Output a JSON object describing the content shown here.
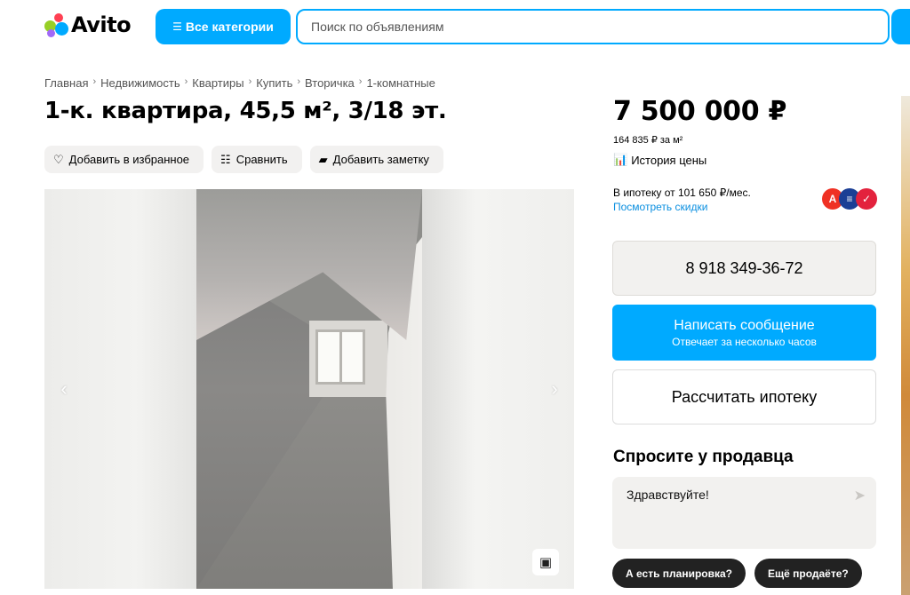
{
  "header": {
    "logo_text": "Avito",
    "categories_label": "Все категории",
    "search_placeholder": "Поиск по объявлениям"
  },
  "breadcrumbs": [
    "Главная",
    "Недвижимость",
    "Квартиры",
    "Купить",
    "Вторичка",
    "1-комнатные"
  ],
  "listing": {
    "title": "1-к. квартира, 45,5 м², 3/18 эт.",
    "actions": {
      "favorite": "Добавить в избранное",
      "compare": "Сравнить",
      "note": "Добавить заметку"
    }
  },
  "gallery": {
    "prev_arrow": "‹",
    "next_arrow": "›"
  },
  "sidebar": {
    "price": "7 500 000 ₽",
    "price_per_m2": "164 835 ₽ за м²",
    "price_history": "История цены",
    "mortgage_text": "В ипотеку от 101 650 ₽/мес.",
    "mortgage_link": "Посмотреть скидки",
    "phone": "8 918 349-36-72",
    "message_button": "Написать сообщение",
    "message_sub": "Отвечает за несколько часов",
    "calc_mortgage": "Рассчитать ипотеку",
    "ask_title": "Спросите у продавца",
    "ask_text": "Здравствуйте!",
    "quick_questions": [
      "А есть планировка?",
      "Ещё продаёте?"
    ]
  },
  "colors": {
    "accent": "#00aaff",
    "link": "#0a8fe0",
    "chip_bg": "#222222",
    "button_bg": "#f2f1ef"
  },
  "icons": [
    "heart-icon",
    "compare-icon",
    "note-icon",
    "chart-icon",
    "floorplan-icon",
    "send-icon",
    "search-icon"
  ]
}
